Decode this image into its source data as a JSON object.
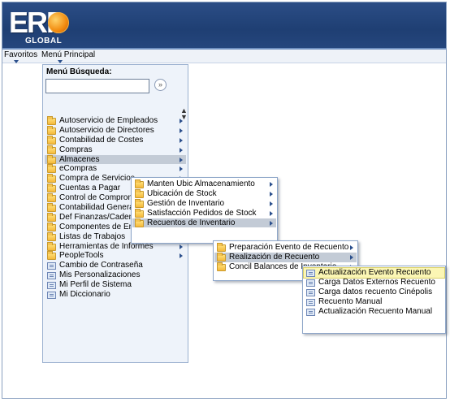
{
  "header": {
    "logo_main": "ERP",
    "logo_sub": "GLOBAL"
  },
  "nav": {
    "favorites": "Favoritos",
    "main_menu": "Menú Principal"
  },
  "search": {
    "label": "Menú Búsqueda:",
    "input_value": "",
    "go_glyph": "»",
    "sort_glyph": "▲▼"
  },
  "main_menu_items": [
    {
      "label": "Autoservicio de Empleados",
      "icon": "folder-icon",
      "submenu": true
    },
    {
      "label": "Autoservicio de Directores",
      "icon": "folder-icon",
      "submenu": true
    },
    {
      "label": "Contabilidad de Costes",
      "icon": "folder-icon",
      "submenu": true
    },
    {
      "label": "Compras",
      "icon": "folder-icon",
      "submenu": true
    },
    {
      "label": "Almacenes",
      "icon": "folder-icon",
      "submenu": true
    },
    {
      "label": "eCompras",
      "icon": "folder-icon",
      "submenu": true
    },
    {
      "label": "Compra de Servicios",
      "icon": "folder-icon",
      "submenu": true
    },
    {
      "label": "Cuentas a Pagar",
      "icon": "folder-icon",
      "submenu": true
    },
    {
      "label": "Control de Compromisos",
      "icon": "folder-icon",
      "submenu": true
    },
    {
      "label": "Contabilidad General",
      "icon": "folder-icon",
      "submenu": true
    },
    {
      "label": "Def Finanzas/Cadena Suministro",
      "icon": "folder-icon",
      "submenu": true
    },
    {
      "label": "Componentes de Empresa",
      "icon": "folder-icon",
      "submenu": true
    },
    {
      "label": "Listas de Trabajos",
      "icon": "folder-icon",
      "submenu": true
    },
    {
      "label": "Herramientas de Informes",
      "icon": "folder-icon",
      "submenu": true
    },
    {
      "label": "PeopleTools",
      "icon": "folder-icon",
      "submenu": true
    },
    {
      "label": "Cambio de Contraseña",
      "icon": "document-icon",
      "submenu": false
    },
    {
      "label": "Mis Personalizaciones",
      "icon": "document-icon",
      "submenu": false
    },
    {
      "label": "Mi Perfil de Sistema",
      "icon": "document-icon",
      "submenu": false
    },
    {
      "label": "Mi Diccionario",
      "icon": "document-icon",
      "submenu": false
    }
  ],
  "almacenes_menu_items": [
    {
      "label": "Manten Ubic Almacenamiento",
      "icon": "folder-icon",
      "submenu": true
    },
    {
      "label": "Ubicación de Stock",
      "icon": "folder-icon",
      "submenu": true
    },
    {
      "label": "Gestión de Inventario",
      "icon": "folder-icon",
      "submenu": true
    },
    {
      "label": "Satisfacción Pedidos de Stock",
      "icon": "folder-icon",
      "submenu": true
    },
    {
      "label": "Recuentos de Inventario",
      "icon": "folder-icon",
      "submenu": true
    }
  ],
  "recuentos_menu_items": [
    {
      "label": "Preparación Evento de Recuento",
      "icon": "folder-icon",
      "submenu": true
    },
    {
      "label": "Realización de Recuento",
      "icon": "folder-icon",
      "submenu": true
    },
    {
      "label": "Concil Balances de Inventario",
      "icon": "folder-icon",
      "submenu": true
    }
  ],
  "realizacion_menu_items": [
    {
      "label": "Actualización Evento Recuento",
      "icon": "document-icon"
    },
    {
      "label": "Carga Datos Externos Recuento",
      "icon": "document-icon"
    },
    {
      "label": "Carga datos recuento Cinépolis",
      "icon": "document-icon"
    },
    {
      "label": "Recuento Manual",
      "icon": "document-icon"
    },
    {
      "label": "Actualización Recuento Manual",
      "icon": "document-icon"
    }
  ],
  "colors": {
    "header_bg": "#1f3f73",
    "panel_bg": "#eef3fa",
    "active_item_bg": "#c3cbd6",
    "hover_item_bg": "#fbf6b4",
    "arrow_color": "#2b4f8c"
  }
}
